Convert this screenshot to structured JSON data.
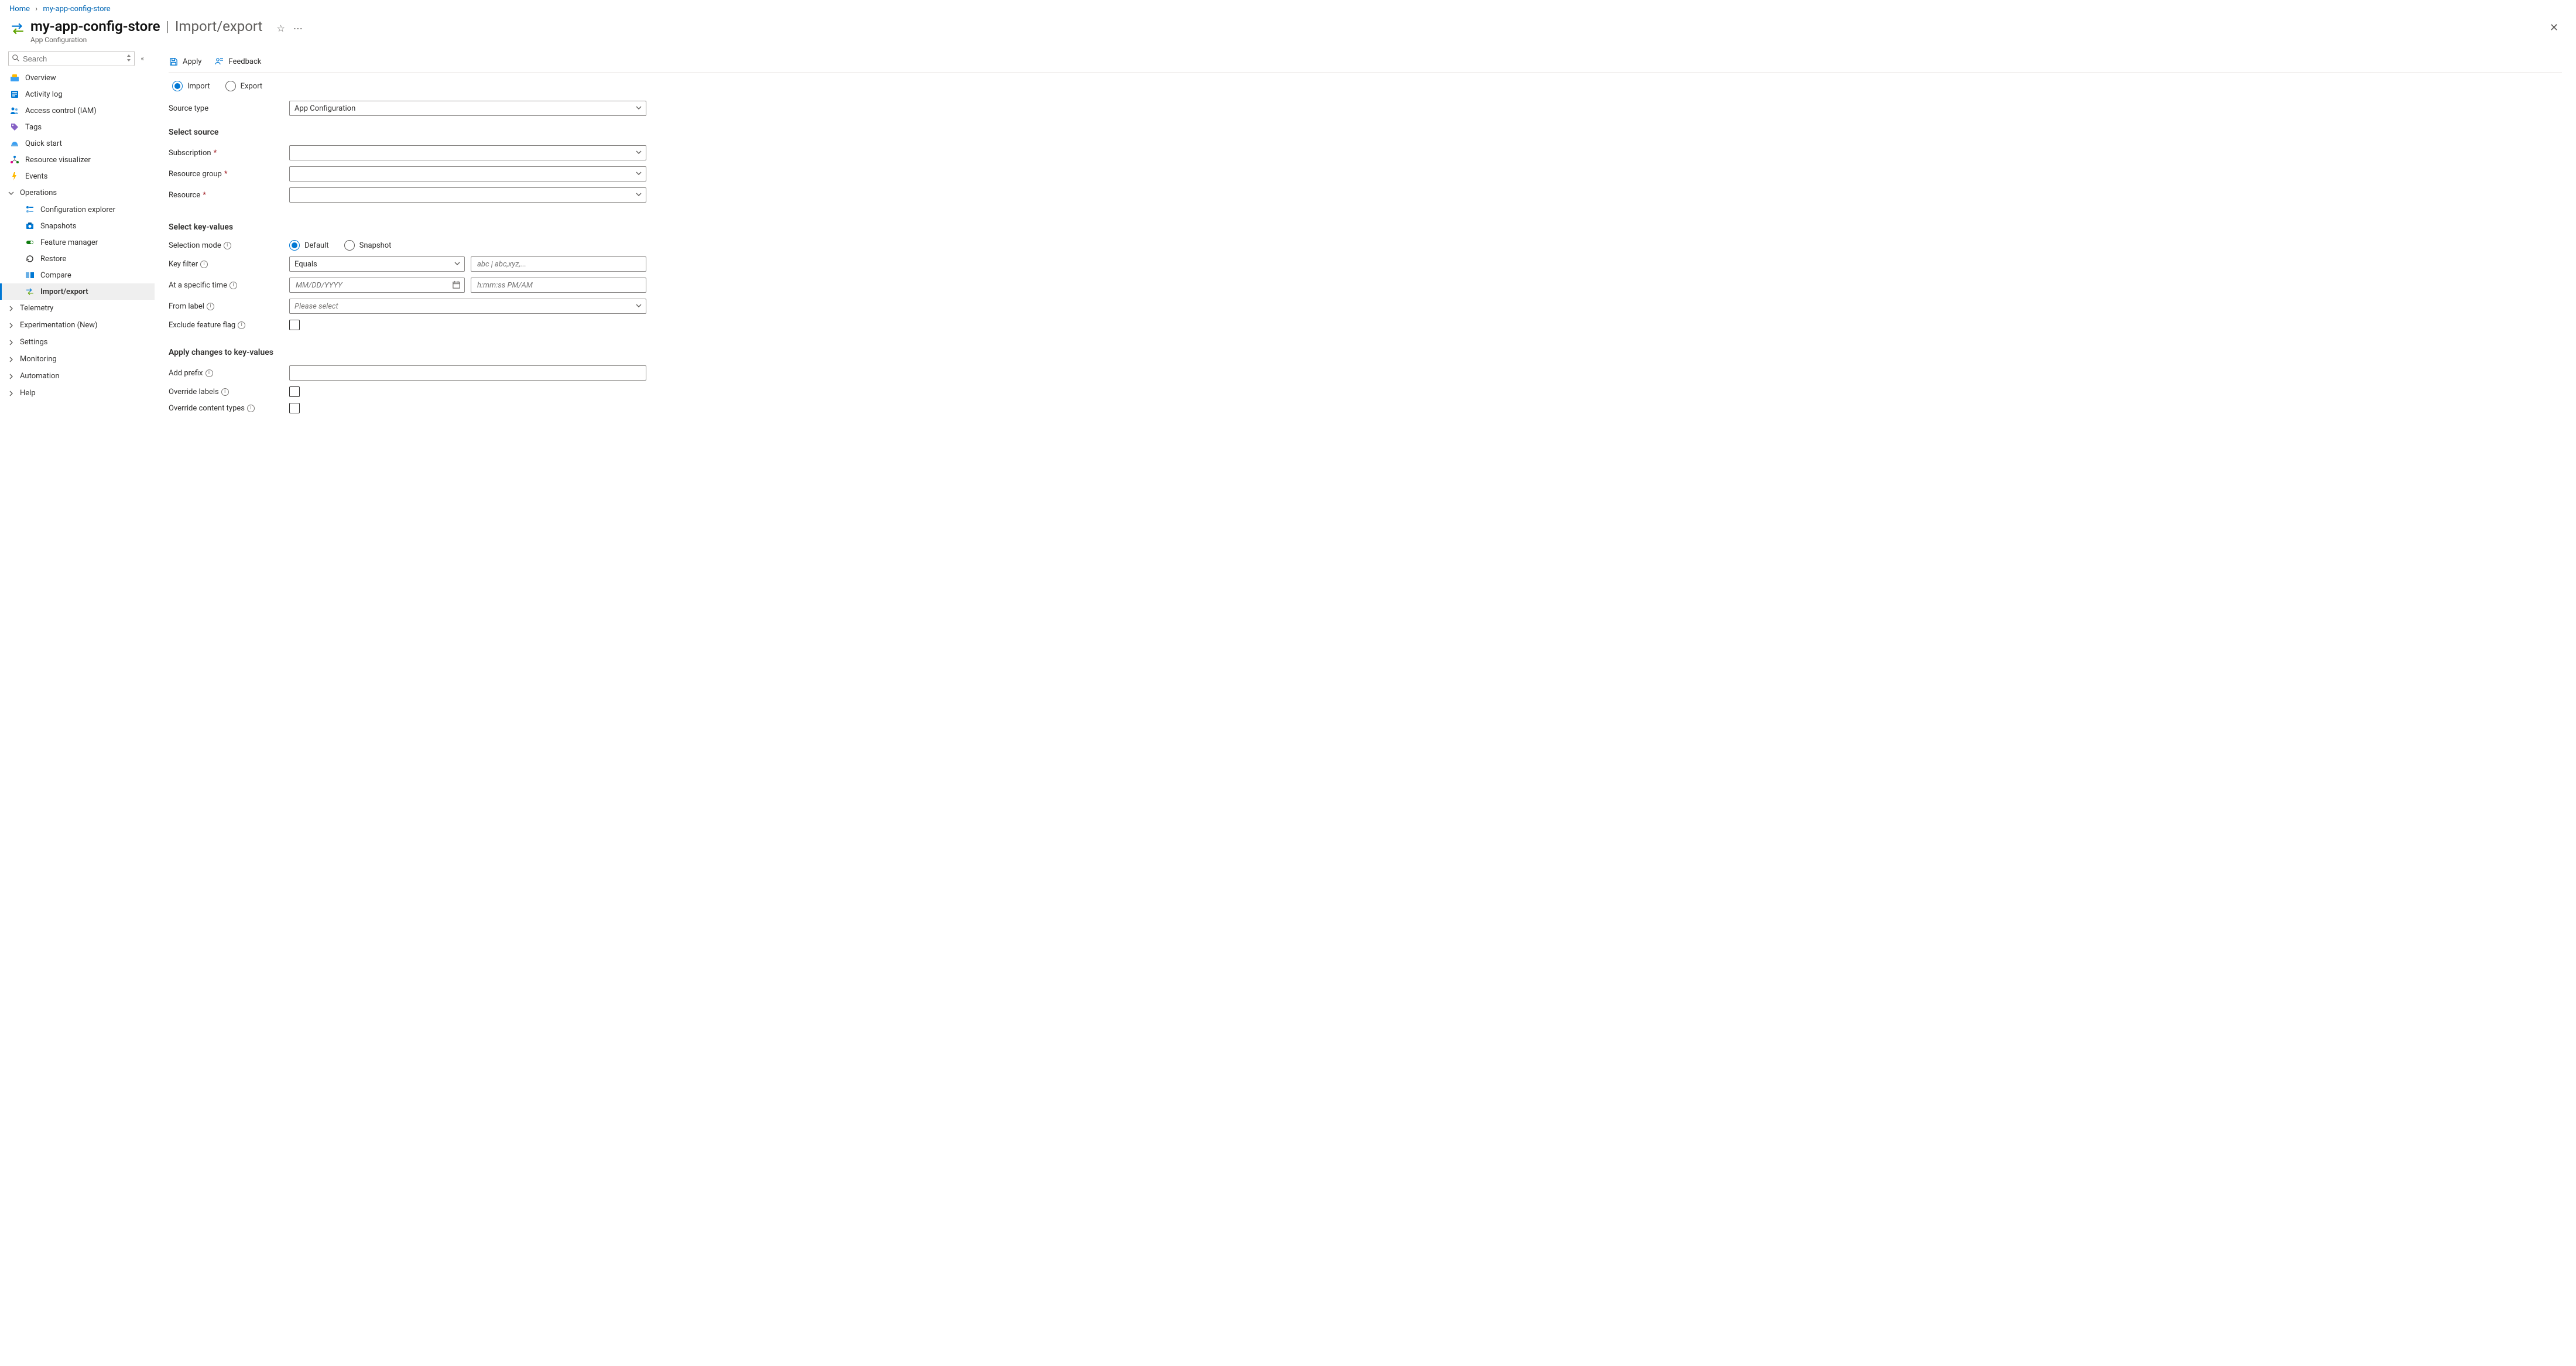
{
  "breadcrumb": {
    "home": "Home",
    "resource": "my-app-config-store"
  },
  "header": {
    "title": "my-app-config-store",
    "section": "Import/export",
    "subtitle": "App Configuration"
  },
  "sidebar": {
    "search_placeholder": "Search",
    "items": {
      "overview": "Overview",
      "activity": "Activity log",
      "iam": "Access control (IAM)",
      "tags": "Tags",
      "quickstart": "Quick start",
      "visualizer": "Resource visualizer",
      "events": "Events"
    },
    "operations_label": "Operations",
    "operations": {
      "config_explorer": "Configuration explorer",
      "snapshots": "Snapshots",
      "feature_manager": "Feature manager",
      "restore": "Restore",
      "compare": "Compare",
      "import_export": "Import/export"
    },
    "groups": {
      "telemetry": "Telemetry",
      "experimentation": "Experimentation (New)",
      "settings": "Settings",
      "monitoring": "Monitoring",
      "automation": "Automation",
      "help": "Help"
    }
  },
  "commands": {
    "apply": "Apply",
    "feedback": "Feedback"
  },
  "form": {
    "mode": {
      "import": "Import",
      "export": "Export",
      "selected": "import"
    },
    "source_type": {
      "label": "Source type",
      "value": "App Configuration"
    },
    "select_source": {
      "title": "Select source",
      "subscription": "Subscription",
      "resource_group": "Resource group",
      "resource": "Resource"
    },
    "select_kv": {
      "title": "Select key-values",
      "selection_mode": "Selection mode",
      "mode_default": "Default",
      "mode_snapshot": "Snapshot",
      "key_filter": "Key filter",
      "key_filter_op": "Equals",
      "key_filter_ph": "abc | abc,xyz,...",
      "at_time": "At a specific time",
      "date_ph": "MM/DD/YYYY",
      "time_ph": "h:mm:ss PM/AM",
      "from_label": "From label",
      "from_label_ph": "Please select",
      "exclude_ff": "Exclude feature flag"
    },
    "apply_changes": {
      "title": "Apply changes to key-values",
      "add_prefix": "Add prefix",
      "override_labels": "Override labels",
      "override_ct": "Override content types"
    }
  }
}
